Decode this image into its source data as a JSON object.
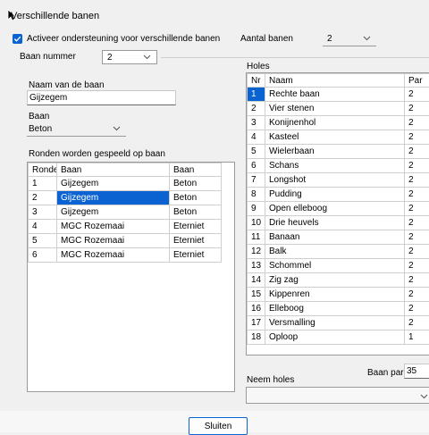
{
  "window": {
    "title": "Verschillende banen"
  },
  "settings": {
    "activate_label": "Activeer ondersteuning voor verschillende banen",
    "activate_checked": true,
    "num_courses_label": "Aantal banen",
    "num_courses_value": "2",
    "course_number_label": "Baan nummer",
    "course_number_value": "2"
  },
  "course": {
    "name_label": "Naam van de baan",
    "name_value": "Gijzegem",
    "type_label": "Baan",
    "type_value": "Beton"
  },
  "rounds": {
    "label": "Ronden worden gespeeld op baan",
    "columns": [
      "Ronde",
      "Baan",
      "Baan"
    ],
    "rows": [
      [
        "1",
        "Gijzegem",
        "Beton"
      ],
      [
        "2",
        "Gijzegem",
        "Beton"
      ],
      [
        "3",
        "Gijzegem",
        "Beton"
      ],
      [
        "4",
        "MGC Rozemaai",
        "Eterniet"
      ],
      [
        "5",
        "MGC Rozemaai",
        "Eterniet"
      ],
      [
        "6",
        "MGC Rozemaai",
        "Eterniet"
      ]
    ]
  },
  "holes": {
    "label": "Holes",
    "columns": [
      "Nr",
      "Naam",
      "Par"
    ],
    "rows": [
      [
        "1",
        "Rechte baan",
        "2"
      ],
      [
        "2",
        "Vier stenen",
        "2"
      ],
      [
        "3",
        "Konijnenhol",
        "2"
      ],
      [
        "4",
        "Kasteel",
        "2"
      ],
      [
        "5",
        "Wielerbaan",
        "2"
      ],
      [
        "6",
        "Schans",
        "2"
      ],
      [
        "7",
        "Longshot",
        "2"
      ],
      [
        "8",
        "Pudding",
        "2"
      ],
      [
        "9",
        "Open elleboog",
        "2"
      ],
      [
        "10",
        "Drie heuvels",
        "2"
      ],
      [
        "11",
        "Banaan",
        "2"
      ],
      [
        "12",
        "Balk",
        "2"
      ],
      [
        "13",
        "Schommel",
        "2"
      ],
      [
        "14",
        "Zig zag",
        "2"
      ],
      [
        "15",
        "Kippenren",
        "2"
      ],
      [
        "16",
        "Elleboog",
        "2"
      ],
      [
        "17",
        "Versmalling",
        "2"
      ],
      [
        "18",
        "Oploop",
        "1"
      ]
    ],
    "course_par_label": "Baan par",
    "course_par_value": "35",
    "take_holes_label": "Neem holes",
    "take_holes_value": ""
  },
  "footer": {
    "close_label": "Sluiten"
  },
  "colors": {
    "accent": "#0a63d0",
    "background": "#f0f0f0"
  }
}
